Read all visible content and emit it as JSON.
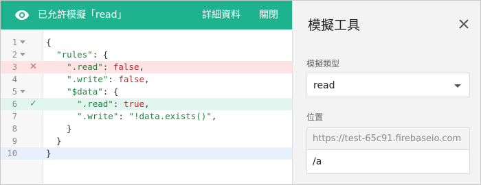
{
  "banner": {
    "status_text": "已允許模擬「read」",
    "details_label": "詳細資料",
    "close_label": "關閉",
    "background_color": "#1eb38e",
    "icon": "eye-icon"
  },
  "editor": {
    "lines": [
      {
        "number": "1",
        "text": "{"
      },
      {
        "number": "2",
        "text": "  \"rules\": {"
      },
      {
        "number": "3",
        "text": "    \".read\": false,"
      },
      {
        "number": "4",
        "text": "    \".write\": false,"
      },
      {
        "number": "5",
        "text": "    \"$data\": {"
      },
      {
        "number": "6",
        "text": "      \".read\": true,"
      },
      {
        "number": "7",
        "text": "      \".write\": \"!data.exists()\","
      },
      {
        "number": "8",
        "text": "    }"
      },
      {
        "number": "9",
        "text": "  }"
      },
      {
        "number": "10",
        "text": "}"
      }
    ],
    "denied_line": 3,
    "allowed_line": 6,
    "current_line": 10,
    "denied_icon": "close-icon",
    "allowed_icon": "check-icon"
  },
  "panel": {
    "title": "模擬工具",
    "close_icon": "close-icon",
    "type_label": "模擬類型",
    "type_value": "read",
    "location_label": "位置",
    "url_prefix": "https://test-65c91.firebaseio.com",
    "path_value": "/a"
  }
}
